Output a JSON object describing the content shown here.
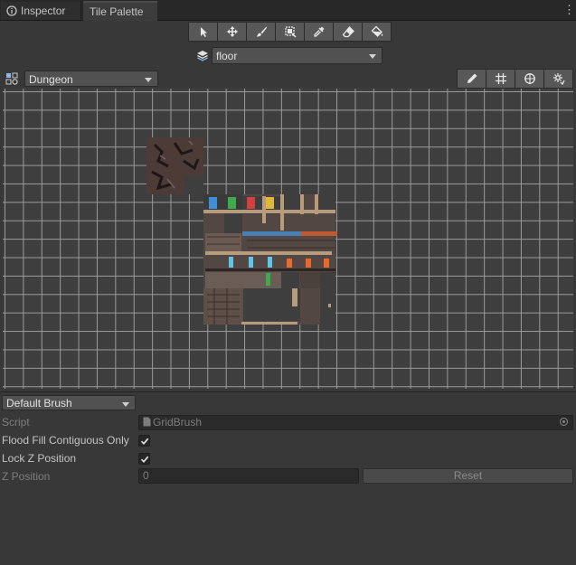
{
  "tabs": [
    {
      "label": "Inspector",
      "icon": "info-icon"
    },
    {
      "label": "Tile Palette",
      "icon": null
    }
  ],
  "menu_icon": "kebab-menu-icon",
  "toolbar": {
    "tools": [
      "select-arrow-icon",
      "move-icon",
      "paintbrush-icon",
      "box-fill-icon",
      "eyedropper-icon",
      "eraser-icon",
      "paint-bucket-icon"
    ]
  },
  "active_layer": {
    "icon": "layers-icon",
    "value": "floor"
  },
  "palette": {
    "icon": "palette-icon",
    "value": "Dungeon"
  },
  "edit_tools": [
    "edit-pencil-icon",
    "grid-toggle-icon",
    "gizmo-icon",
    "settings-icon"
  ],
  "brush": {
    "selected": "Default Brush",
    "script_label": "Script",
    "script_value": "GridBrush",
    "flood_fill_label": "Flood Fill Contiguous Only",
    "flood_fill_checked": true,
    "lock_z_label": "Lock Z Position",
    "lock_z_checked": true,
    "z_position_label": "Z Position",
    "z_position_value": "0",
    "reset_label": "Reset"
  },
  "colors": {
    "background": "#383838",
    "tab_bar": "#282828",
    "button": "#585858",
    "field": "#2a2a2a",
    "grid_line": "#9a9a9a"
  }
}
